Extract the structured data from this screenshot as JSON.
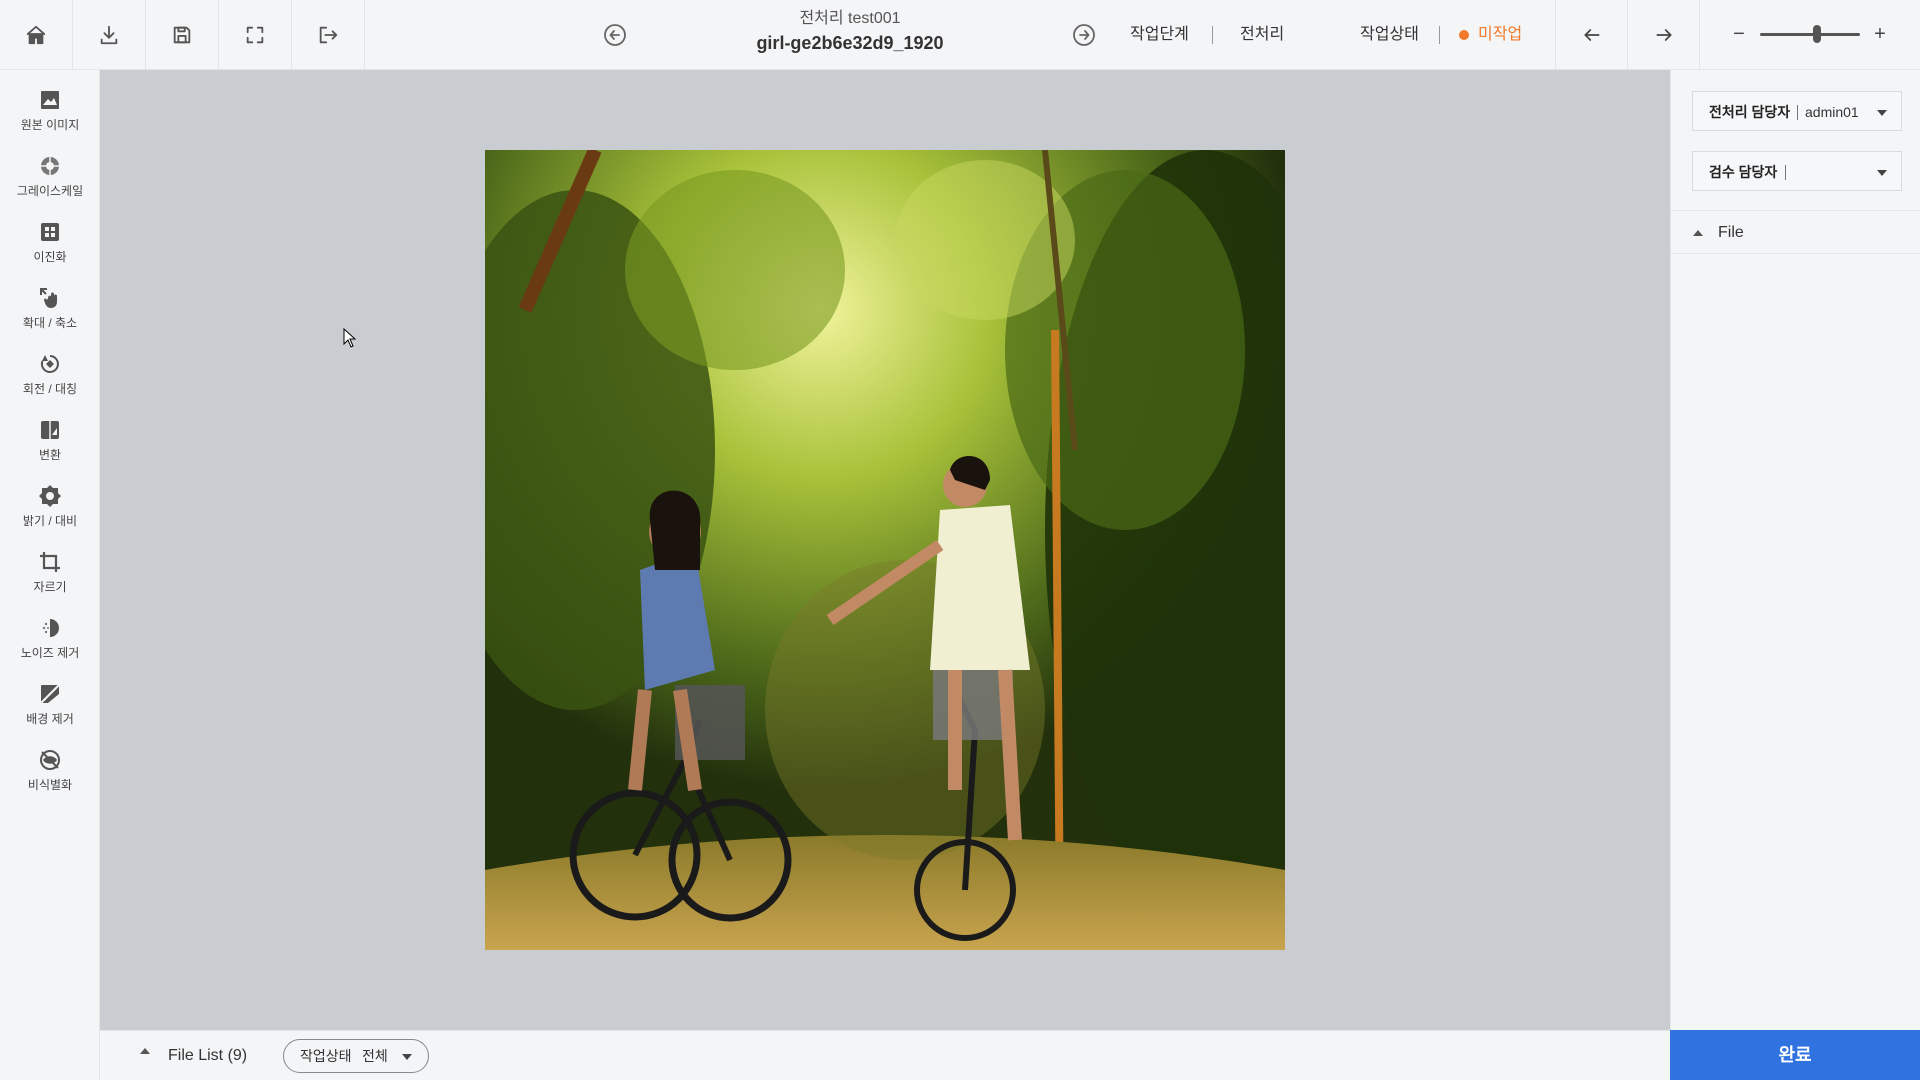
{
  "header": {
    "project_name": "전처리 test001",
    "file_name": "girl-ge2b6e32d9_1920",
    "stage_label": "작업단계",
    "stage_value": "전처리",
    "status_label": "작업상태",
    "status_value": "미작업",
    "status_color": "#f07a2a",
    "zoom_minus": "−",
    "zoom_plus": "+"
  },
  "toolbar": {
    "buttons": [
      "home-icon",
      "download-icon",
      "save-icon",
      "fullscreen-icon",
      "exit-icon"
    ]
  },
  "tools": [
    {
      "icon": "image-icon",
      "label": "원본 이미지"
    },
    {
      "icon": "grayscale-icon",
      "label": "그레이스케일"
    },
    {
      "icon": "binarize-icon",
      "label": "이진화"
    },
    {
      "icon": "zoom-hand-icon",
      "label": "확대 / 축소"
    },
    {
      "icon": "rotate-icon",
      "label": "회전 / 대칭"
    },
    {
      "icon": "convert-icon",
      "label": "변환"
    },
    {
      "icon": "brightness-icon",
      "label": "밝기 / 대비"
    },
    {
      "icon": "crop-icon",
      "label": "자르기"
    },
    {
      "icon": "denoise-icon",
      "label": "노이즈 제거"
    },
    {
      "icon": "remove-background-icon",
      "label": "배경 제거"
    },
    {
      "icon": "deidentify-icon",
      "label": "비식별화"
    }
  ],
  "right_panel": {
    "preprocess_manager_label": "전처리 담당자",
    "preprocess_manager_value": "admin01",
    "inspect_manager_label": "검수 담당자",
    "inspect_manager_value": "",
    "file_section": "File"
  },
  "bottom": {
    "file_list": "File List (9)",
    "filter_label": "작업상태",
    "filter_value": "전체",
    "complete_button": "완료"
  }
}
